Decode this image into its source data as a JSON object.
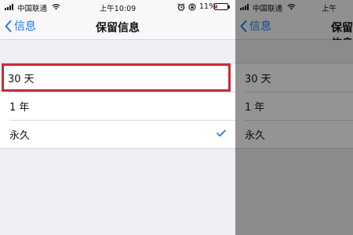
{
  "status_bar": {
    "carrier": "中国联通",
    "time": "上午10:09",
    "battery_percent": "11%",
    "battery_level": 0.11,
    "battery_color": "#ff3b30"
  },
  "navbar": {
    "back_label": "信息",
    "title": "保留信息"
  },
  "options": [
    {
      "label": "30 天",
      "selected": false,
      "highlighted": true
    },
    {
      "label": "1 年",
      "selected": false,
      "highlighted": false
    },
    {
      "label": "永久",
      "selected": true,
      "highlighted": false
    }
  ],
  "accent_color": "#1d7af3",
  "highlight_color": "#c62b39",
  "icons": {
    "signal": "cellular-signal-icon",
    "wifi": "wifi-icon",
    "alarm": "alarm-icon",
    "rotation_lock": "rotation-lock-icon",
    "battery": "battery-icon",
    "back": "chevron-left-icon",
    "check": "checkmark-icon"
  }
}
